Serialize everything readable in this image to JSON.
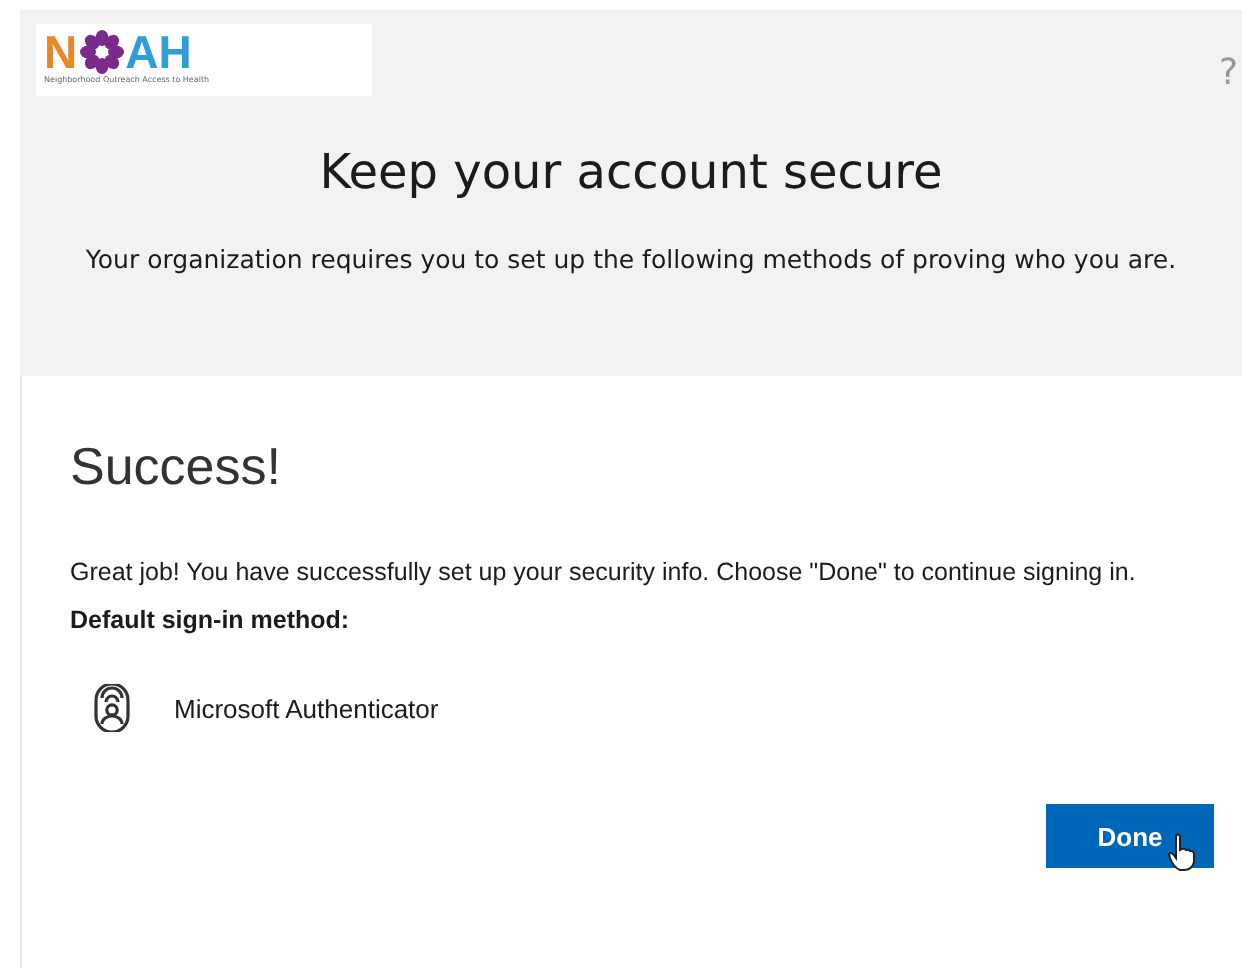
{
  "header": {
    "logo": {
      "letters": [
        "N",
        "AH"
      ],
      "tagline": "Neighborhood Outreach Access to Health"
    },
    "help": "?"
  },
  "title": "Keep your account secure",
  "subtitle": "Your organization requires you to set up the following methods of proving who you are.",
  "card": {
    "heading": "Success!",
    "message": "Great job! You have successfully set up your security info. Choose \"Done\" to continue signing in.",
    "default_label": "Default sign-in method:",
    "method": "Microsoft Authenticator",
    "button": "Done"
  }
}
